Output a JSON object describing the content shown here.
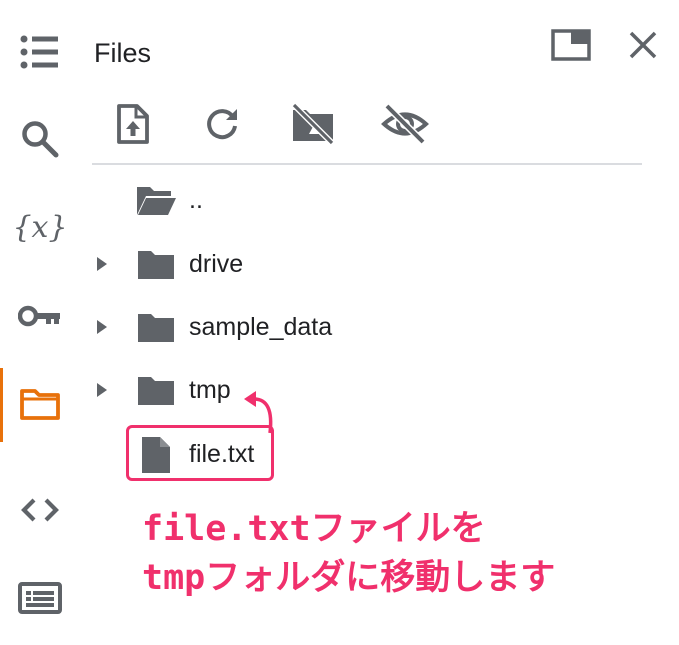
{
  "panel": {
    "title": "Files"
  },
  "sidebar": {
    "icons": [
      "table-of-contents-icon",
      "search-icon",
      "variables-icon",
      "secrets-key-icon",
      "folder-icon",
      "code-snippets-icon",
      "command-palette-icon"
    ],
    "active_color": "#e8710a",
    "variables_glyph": "{x}"
  },
  "toolbar": {
    "icons": [
      "upload-file-icon",
      "refresh-icon",
      "mount-drive-off-icon",
      "hide-hidden-files-icon"
    ]
  },
  "files": [
    {
      "name": "..",
      "type": "folder-open",
      "expandable": false
    },
    {
      "name": "drive",
      "type": "folder",
      "expandable": true
    },
    {
      "name": "sample_data",
      "type": "folder",
      "expandable": true
    },
    {
      "name": "tmp",
      "type": "folder",
      "expandable": true
    },
    {
      "name": "file.txt",
      "type": "file",
      "expandable": false
    }
  ],
  "annotation": {
    "line1": "file.txtファイルを",
    "line2": "tmpフォルダに移動します",
    "color": "#f0306c"
  }
}
